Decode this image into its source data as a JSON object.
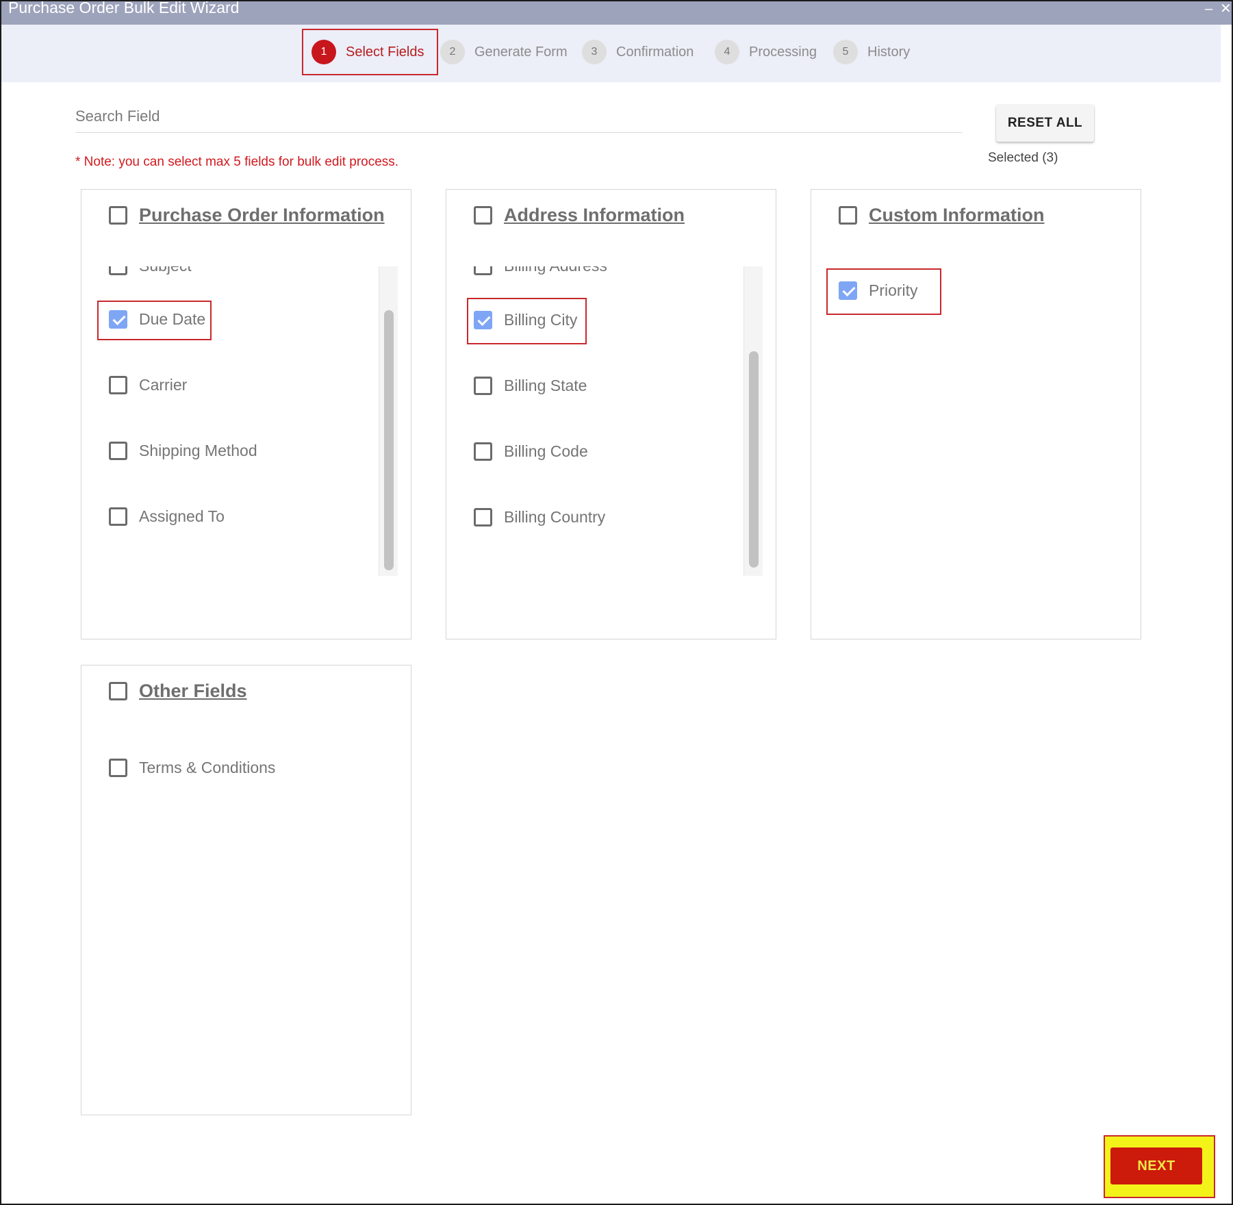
{
  "window": {
    "title": "Purchase Order Bulk Edit Wizard",
    "minimize_glyph": "–",
    "close_glyph": "✕"
  },
  "steps": [
    {
      "number": "1",
      "label": "Select Fields",
      "active": true
    },
    {
      "number": "2",
      "label": "Generate Form",
      "active": false
    },
    {
      "number": "3",
      "label": "Confirmation",
      "active": false
    },
    {
      "number": "4",
      "label": "Processing",
      "active": false
    },
    {
      "number": "5",
      "label": "History",
      "active": false
    }
  ],
  "search": {
    "placeholder": "Search Field",
    "value": ""
  },
  "reset_label": "RESET ALL",
  "selected_label": "Selected (3)",
  "note": "* Note: you can select max 5 fields for bulk edit process.",
  "sections": [
    {
      "title": "Purchase Order Information",
      "checked": false,
      "fields": [
        {
          "label": "Subject",
          "checked": false
        },
        {
          "label": "Due Date",
          "checked": true
        },
        {
          "label": "Carrier",
          "checked": false
        },
        {
          "label": "Shipping Method",
          "checked": false
        },
        {
          "label": "Assigned To",
          "checked": false
        }
      ]
    },
    {
      "title": "Address Information",
      "checked": false,
      "fields": [
        {
          "label": "Billing Address",
          "checked": false
        },
        {
          "label": "Billing City",
          "checked": true
        },
        {
          "label": "Billing State",
          "checked": false
        },
        {
          "label": "Billing Code",
          "checked": false
        },
        {
          "label": "Billing Country",
          "checked": false
        }
      ]
    },
    {
      "title": "Custom Information",
      "checked": false,
      "fields": [
        {
          "label": "Priority",
          "checked": true
        }
      ]
    },
    {
      "title": "Other Fields",
      "checked": false,
      "fields": [
        {
          "label": "Terms & Conditions",
          "checked": false
        }
      ]
    }
  ],
  "next_label": "NEXT",
  "colors": {
    "accent_red": "#c8161d",
    "checked_blue": "#7fa6f5",
    "titlebar": "#9ea3bc",
    "highlight_yellow": "#f3f31a"
  }
}
